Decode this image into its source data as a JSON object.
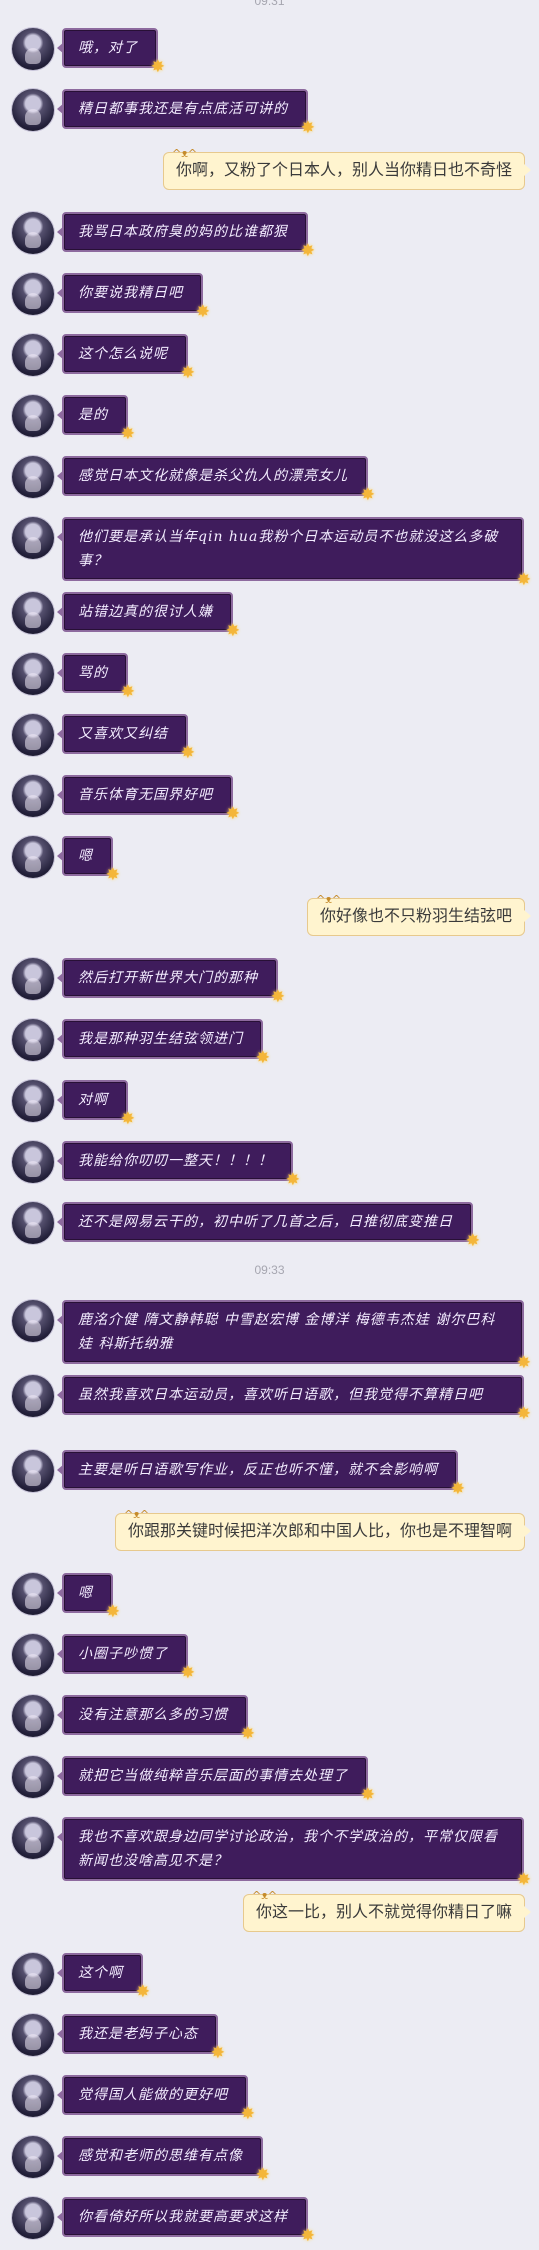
{
  "timestamps": [
    "09:31",
    "09:33"
  ],
  "messages": [
    {
      "side": "left",
      "text": "哦，对了"
    },
    {
      "side": "left",
      "text": "精日都事我还是有点底活可讲的"
    },
    {
      "side": "right",
      "text": "你啊，又粉了个日本人，别人当你精日也不奇怪"
    },
    {
      "side": "left",
      "text": "我骂日本政府臭的妈的比谁都狠"
    },
    {
      "side": "left",
      "text": "你要说我精日吧"
    },
    {
      "side": "left",
      "text": "这个怎么说呢"
    },
    {
      "side": "left",
      "text": "是的"
    },
    {
      "side": "left",
      "text": "感觉日本文化就像是杀父仇人的漂亮女儿"
    },
    {
      "side": "left",
      "text": "他们要是承认当年qin hua我粉个日本运动员不也就没这么多破事？"
    },
    {
      "side": "left",
      "text": "站错边真的很讨人嫌"
    },
    {
      "side": "left",
      "text": "骂的"
    },
    {
      "side": "left",
      "text": "又喜欢又纠结"
    },
    {
      "side": "left",
      "text": "音乐体育无国界好吧"
    },
    {
      "side": "left",
      "text": "嗯"
    },
    {
      "side": "right",
      "text": "你好像也不只粉羽生结弦吧"
    },
    {
      "side": "left",
      "text": "然后打开新世界大门的那种"
    },
    {
      "side": "left",
      "text": "我是那种羽生结弦领进门"
    },
    {
      "side": "left",
      "text": "对啊"
    },
    {
      "side": "left",
      "text": "我能给你叨叨一整天！！！！"
    },
    {
      "side": "left",
      "text": "还不是网易云干的，初中听了几首之后，日推彻底变推日"
    },
    {
      "side": "left",
      "text": "鹿洺介健 隋文静韩聪 中雪赵宏博 金博洋 梅德韦杰娃 谢尔巴科娃 科斯托纳雅"
    },
    {
      "side": "left",
      "text": "虽然我喜欢日本运动员，喜欢听日语歌，但我觉得不算精日吧"
    },
    {
      "side": "left",
      "text": "主要是听日语歌写作业，反正也听不懂，就不会影响啊"
    },
    {
      "side": "right",
      "text": "你跟那关键时候把洋次郎和中国人比，你也是不理智啊"
    },
    {
      "side": "left",
      "text": "嗯"
    },
    {
      "side": "left",
      "text": "小圈子吵惯了"
    },
    {
      "side": "left",
      "text": "没有注意那么多的习惯"
    },
    {
      "side": "left",
      "text": "就把它当做纯粹音乐层面的事情去处理了"
    },
    {
      "side": "left",
      "text": "我也不喜欢跟身边同学讨论政治，我个不学政治的，平常仅限看新闻也没啥高见不是？"
    },
    {
      "side": "right",
      "text": "你这一比，别人不就觉得你精日了嘛"
    },
    {
      "side": "left",
      "text": "这个啊"
    },
    {
      "side": "left",
      "text": "我还是老妈子心态"
    },
    {
      "side": "left",
      "text": "觉得国人能做的更好吧"
    },
    {
      "side": "left",
      "text": "感觉和老师的思维有点像"
    },
    {
      "side": "left",
      "text": "你看倚好所以我就要高要求这样"
    }
  ]
}
